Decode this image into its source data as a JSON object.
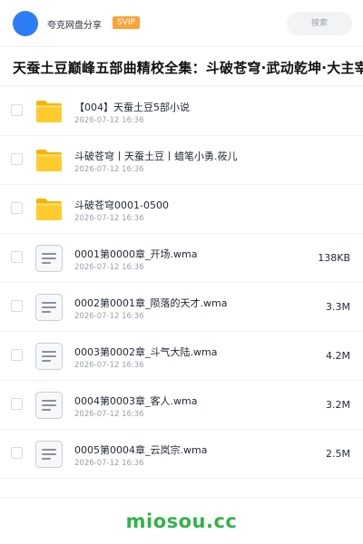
{
  "header": {
    "share_name": "夸克网盘分享",
    "badge": "SVIP",
    "search_label": "搜索",
    "avatar_color": "#2e7cf6",
    "badge_color": "#f7a43b"
  },
  "title": "天蚕土豆巅峰五部曲精校全集：斗破苍穹·武动乾坤·大主宰",
  "files": [
    {
      "type": "folder",
      "icon": "folder-icon",
      "name": "【004】天蚕土豆5部小说",
      "date": "2026-07-12 16:36",
      "size": ""
    },
    {
      "type": "folder",
      "icon": "folder-icon",
      "name": "斗破苍穹丨天蚕土豆丨蜡笔小勇.莜儿",
      "date": "2026-07-12 16:36",
      "size": ""
    },
    {
      "type": "folder",
      "icon": "folder-icon",
      "name": "斗破苍穹0001-0500",
      "date": "2026-07-12 16:36",
      "size": ""
    },
    {
      "type": "file",
      "icon": "document-icon",
      "name": "0001第0000章_开场.wma",
      "date": "2026-07-12 16:36",
      "size": "138KB"
    },
    {
      "type": "file",
      "icon": "document-icon",
      "name": "0002第0001章_陨落的天才.wma",
      "date": "2026-07-12 16:36",
      "size": "3.3M"
    },
    {
      "type": "file",
      "icon": "document-icon",
      "name": "0003第0002章_斗气大陆.wma",
      "date": "2026-07-12 16:36",
      "size": "4.2M"
    },
    {
      "type": "file",
      "icon": "document-icon",
      "name": "0004第0003章_客人.wma",
      "date": "2026-07-12 16:36",
      "size": "3.2M"
    },
    {
      "type": "file",
      "icon": "document-icon",
      "name": "0005第0004章_云岚宗.wma",
      "date": "2026-07-12 16:36",
      "size": "2.5M"
    }
  ],
  "footer": {
    "brand": "miosou.cc",
    "brand_color": "#33b24a"
  }
}
